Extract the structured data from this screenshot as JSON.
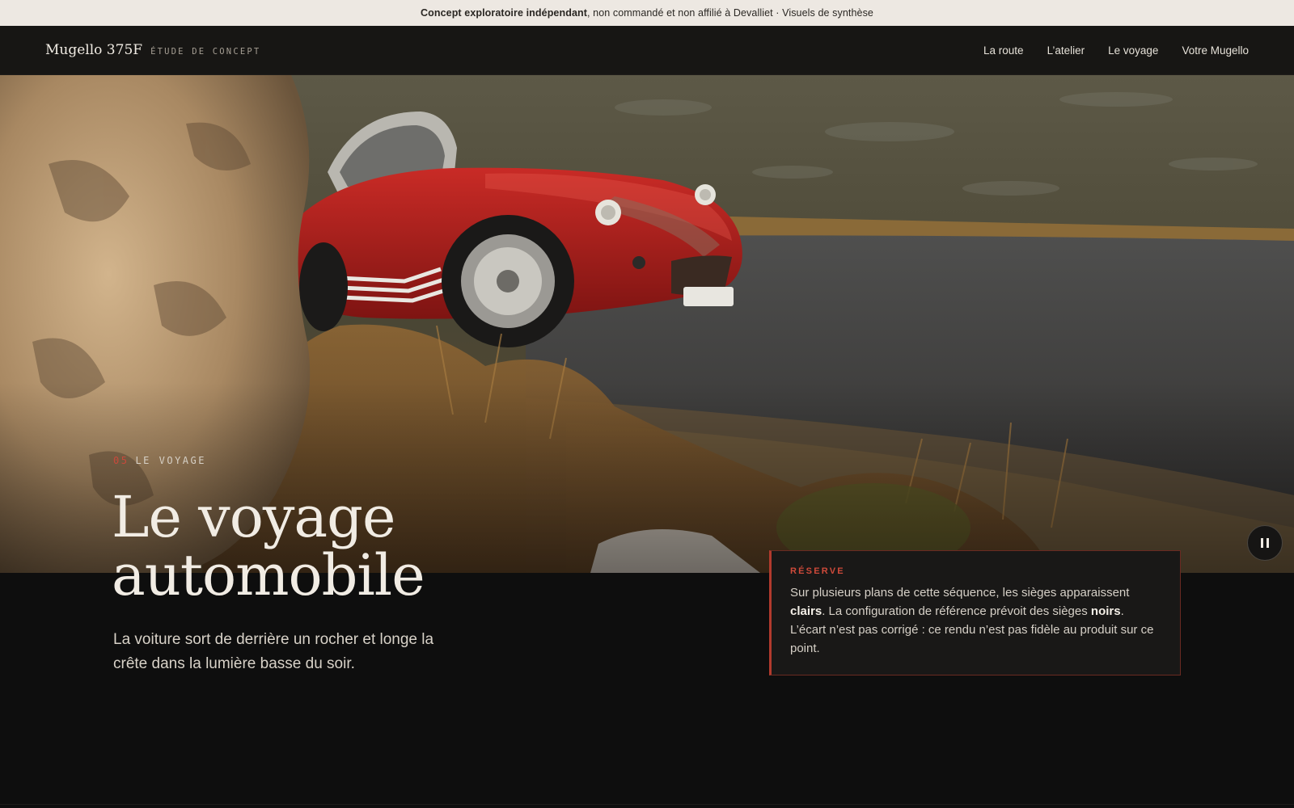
{
  "disclaimer": {
    "bold": "Concept exploratoire indépendant",
    "rest": ", non commandé et non affilié à Devalliet · Visuels de synthèse"
  },
  "nav": {
    "brand_name": "Mugello 375F",
    "brand_sub": "ÉTUDE DE CONCEPT",
    "links": [
      "La route",
      "L’atelier",
      "Le voyage",
      "Votre Mugello"
    ]
  },
  "hero": {
    "eyebrow_number": "05",
    "eyebrow_label": "LE VOYAGE",
    "title_line1": "Le voyage",
    "title_line2": "automobile",
    "lede": "La voiture sort de derrière un rocher et longe la crête dans la lumière basse du soir."
  },
  "reserve": {
    "title": "RÉSERVE",
    "body_1": "Sur plusieurs plans de cette séquence, les sièges apparaissent ",
    "body_bold_1": "clairs",
    "body_2": ". La configuration de référence prévoit des sièges ",
    "body_bold_2": "noirs",
    "body_3": ". L’écart n’est pas corrigé : ce rendu n’est pas fidèle au produit sur ce point."
  },
  "player": {
    "icon": "pause-icon"
  },
  "colors": {
    "accent": "#c9493b",
    "background": "#0e0e0e",
    "disclaimer_bg": "#ede8e2",
    "car_red": "#b0201f"
  }
}
